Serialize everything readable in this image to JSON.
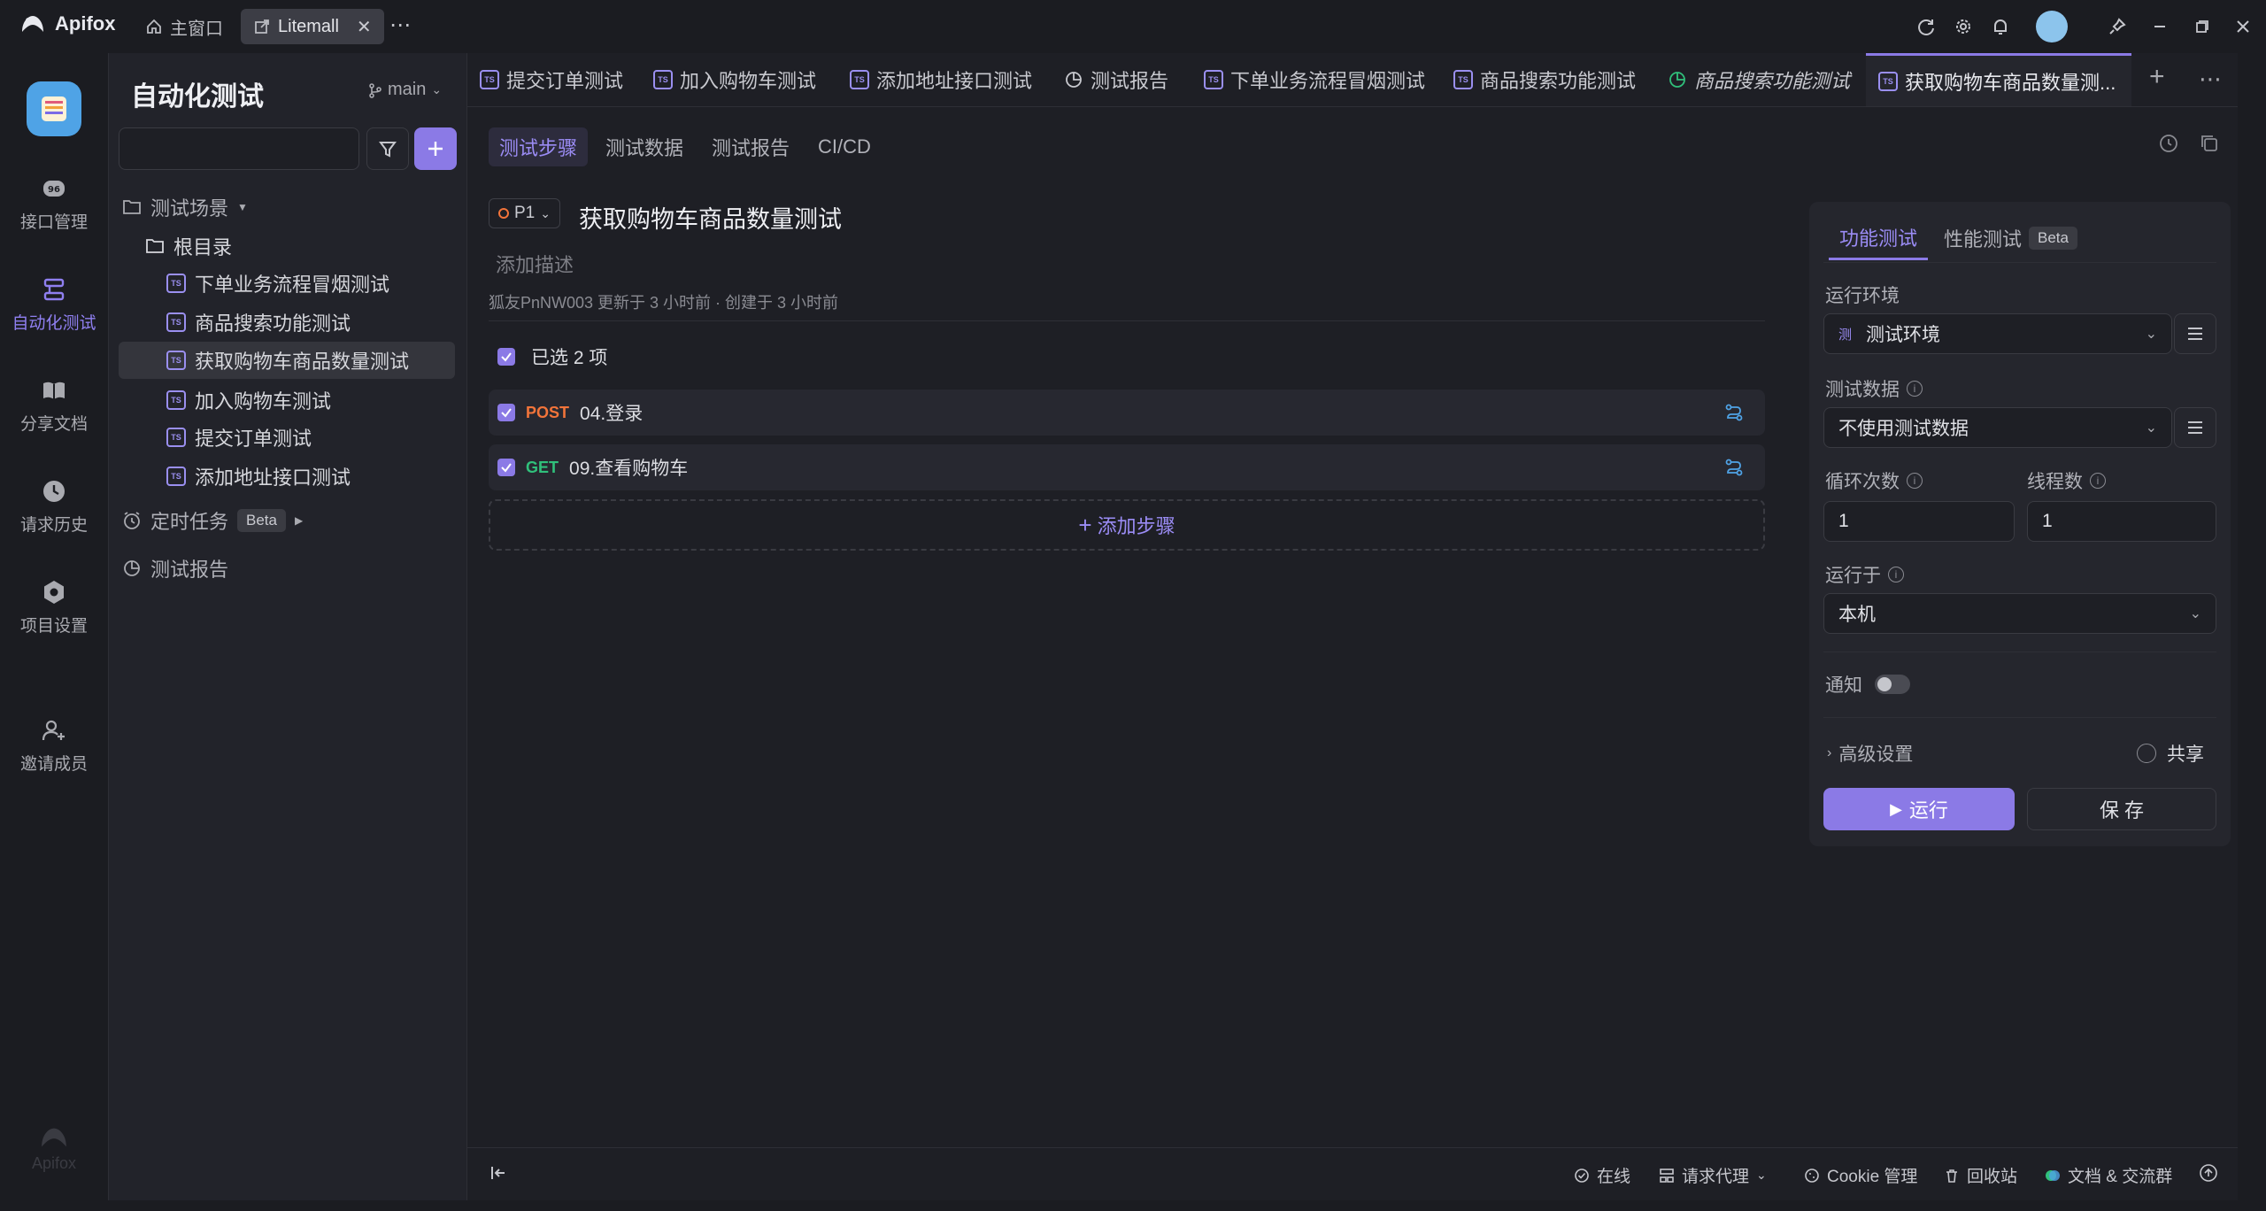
{
  "app": {
    "name": "Apifox"
  },
  "window_tabs": [
    {
      "label": "主窗口",
      "icon": "home-icon"
    },
    {
      "label": "Litemall",
      "icon": "external-icon"
    }
  ],
  "title_icons": [
    "refresh-icon",
    "gear-icon",
    "bell-icon",
    "avatar",
    "pin-icon",
    "minimize-icon",
    "maximize-icon",
    "close-icon"
  ],
  "rail": {
    "items": [
      {
        "label": "接口管理",
        "icon": "api-icon"
      },
      {
        "label": "自动化测试",
        "icon": "automation-icon"
      },
      {
        "label": "分享文档",
        "icon": "book-icon"
      },
      {
        "label": "请求历史",
        "icon": "clock-icon"
      },
      {
        "label": "项目设置",
        "icon": "settings-icon"
      },
      {
        "label": "邀请成员",
        "icon": "invite-icon"
      }
    ],
    "footer": "Apifox"
  },
  "sidebar": {
    "title": "自动化测试",
    "branch": "main",
    "search_placeholder": "",
    "scenes_label": "测试场景",
    "root_label": "根目录",
    "cases": [
      "下单业务流程冒烟测试",
      "商品搜索功能测试",
      "获取购物车商品数量测试",
      "加入购物车测试",
      "提交订单测试",
      "添加地址接口测试"
    ],
    "scheduled_label": "定时任务",
    "scheduled_badge": "Beta",
    "reports_label": "测试报告"
  },
  "doc_tabs": [
    "提交订单测试",
    "加入购物车测试",
    "添加地址接口测试",
    "测试报告",
    "下单业务流程冒烟测试",
    "商品搜索功能测试",
    "商品搜索功能测试",
    "获取购物车商品数量测..."
  ],
  "sub_tabs": [
    "测试步骤",
    "测试数据",
    "测试报告",
    "CI/CD"
  ],
  "case": {
    "priority": "P1",
    "title": "获取购物车商品数量测试",
    "description_placeholder": "添加描述",
    "meta": "狐友PnNW003 更新于 3 小时前 · 创建于 3 小时前",
    "selected_text": "已选 2 项",
    "steps": [
      {
        "method": "POST",
        "name": "04.登录"
      },
      {
        "method": "GET",
        "name": "09.查看购物车"
      }
    ],
    "add_step": "添加步骤"
  },
  "panel": {
    "tabs": [
      "功能测试",
      "性能测试"
    ],
    "perf_badge": "Beta",
    "env_label": "运行环境",
    "env_badge": "测",
    "env_value": "测试环境",
    "data_label": "测试数据",
    "data_value": "不使用测试数据",
    "loop_label": "循环次数",
    "loop_value": "1",
    "thread_label": "线程数",
    "thread_value": "1",
    "runon_label": "运行于",
    "runon_value": "本机",
    "notify_label": "通知",
    "advanced_label": "高级设置",
    "share_label": "共享",
    "run_label": "运行",
    "save_label": "保 存"
  },
  "statusbar": {
    "online": "在线",
    "proxy": "请求代理",
    "cookie": "Cookie 管理",
    "recycle": "回收站",
    "docs": "文档 & 交流群"
  },
  "colors": {
    "accent": "#8b7ae6",
    "post": "#f2743a",
    "get": "#30c07b"
  }
}
